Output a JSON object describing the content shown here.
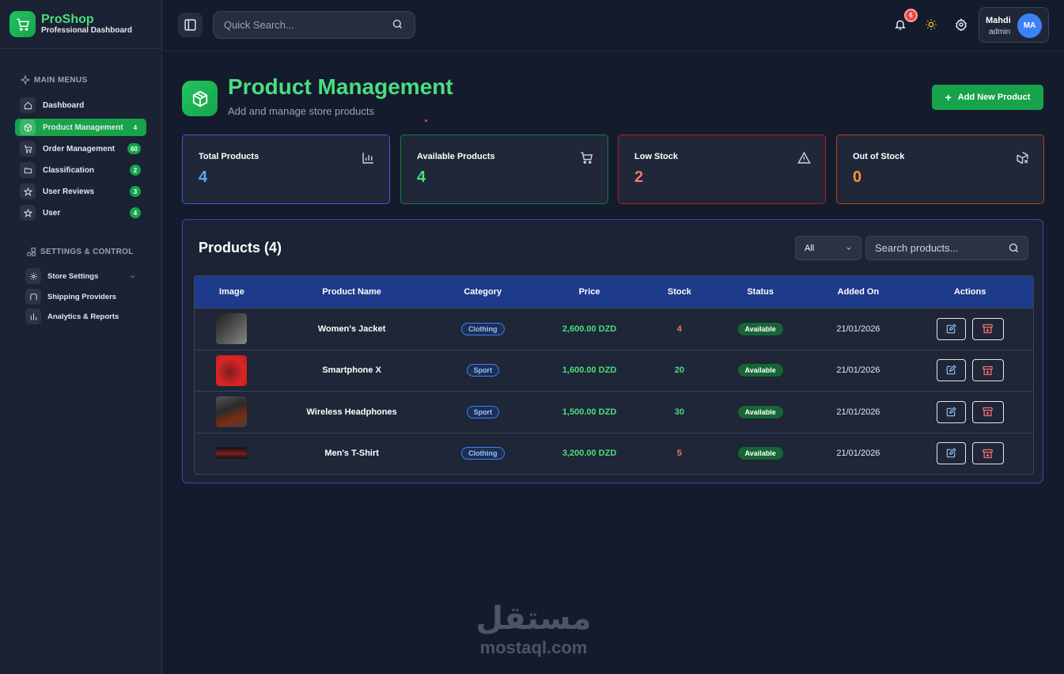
{
  "brand": {
    "name": "ProShop",
    "subtitle": "Professional Dashboard"
  },
  "sidebar": {
    "main_title": "MAIN MENUS",
    "items": [
      {
        "label": "Dashboard",
        "badge": ""
      },
      {
        "label": "Product Management",
        "badge": "4"
      },
      {
        "label": "Order Management",
        "badge": "60"
      },
      {
        "label": "Classification",
        "badge": "2"
      },
      {
        "label": "User Reviews",
        "badge": "3"
      },
      {
        "label": "User",
        "badge": "4"
      }
    ],
    "settings_title": "SETTINGS & CONTROL",
    "settings_items": [
      {
        "label": "Store Settings"
      },
      {
        "label": "Shipping Providers"
      },
      {
        "label": "Analytics & Reports"
      }
    ]
  },
  "topbar": {
    "search_placeholder": "Quick Search...",
    "notification_count": "6",
    "user_name": "Mahdi",
    "user_role": "admin",
    "user_initials": "MA"
  },
  "header": {
    "title": "Product Management",
    "subtitle": "Add and manage store products",
    "add_button": "Add New Product"
  },
  "stats": [
    {
      "label": "Total Products",
      "value": "4",
      "color": "#60a5fa",
      "border": "#3b5bdb"
    },
    {
      "label": "Available Products",
      "value": "4",
      "color": "#4ade80",
      "border": "#15803d"
    },
    {
      "label": "Low Stock",
      "value": "2",
      "color": "#f87171",
      "border": "#b91c1c"
    },
    {
      "label": "Out of Stock",
      "value": "0",
      "color": "#fb923c",
      "border": "#c2410c"
    }
  ],
  "products": {
    "title": "Products (4)",
    "filter_value": "All",
    "search_placeholder": "Search products...",
    "columns": [
      "Image",
      "Product Name",
      "Category",
      "Price",
      "Stock",
      "Status",
      "Added On",
      "Actions"
    ],
    "rows": [
      {
        "name": "Women's Jacket",
        "category": "Clothing",
        "price": "2,600.00 DZD",
        "stock": "4",
        "stock_color": "#f87171",
        "status": "Available",
        "date": "21/01/2026"
      },
      {
        "name": "Smartphone X",
        "category": "Sport",
        "price": "1,600.00 DZD",
        "stock": "20",
        "stock_color": "#4ade80",
        "status": "Available",
        "date": "21/01/2026"
      },
      {
        "name": "Wireless Headphones",
        "category": "Sport",
        "price": "1,500.00 DZD",
        "stock": "30",
        "stock_color": "#4ade80",
        "status": "Available",
        "date": "21/01/2026"
      },
      {
        "name": "Men's T-Shirt",
        "category": "Clothing",
        "price": "3,200.00 DZD",
        "stock": "5",
        "stock_color": "#f87171",
        "status": "Available",
        "date": "21/01/2026"
      }
    ]
  },
  "watermark": {
    "arabic": "مستقل",
    "latin": "mostaql.com"
  }
}
